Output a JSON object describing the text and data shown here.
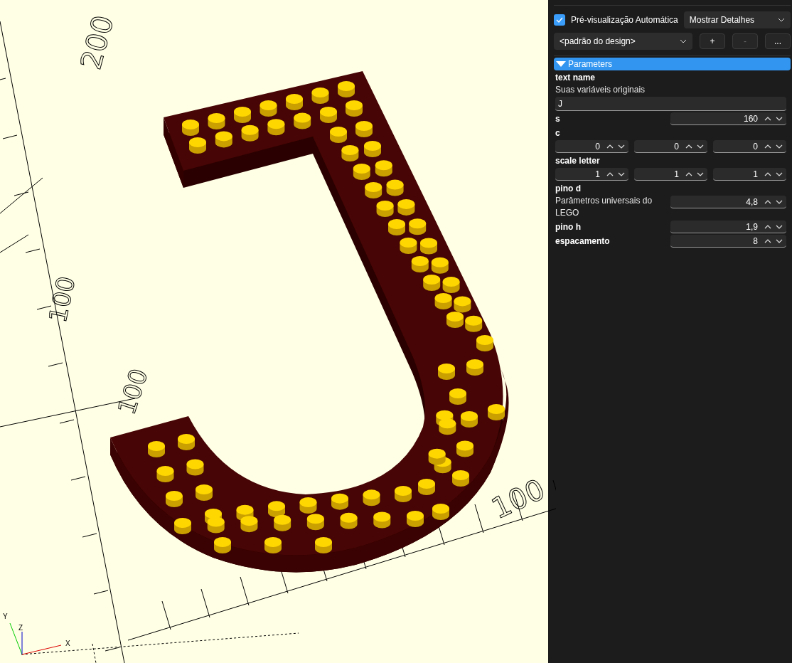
{
  "viewport": {
    "scale_labels": [
      "200",
      "100",
      "100",
      "100"
    ],
    "axis_labels": [
      "X",
      "Y",
      "Z"
    ]
  },
  "customizer": {
    "auto_preview": {
      "label": "Pré-visualização Automática",
      "checked": true
    },
    "detail_select": "Mostrar Detalhes",
    "preset_select": "<padrão do design>",
    "preset_buttons": [
      {
        "label": "+",
        "disabled": false
      },
      {
        "label": "-",
        "disabled": true
      },
      {
        "label": "...",
        "disabled": false
      }
    ],
    "group": {
      "title": "Parameters",
      "expanded": true,
      "params": [
        {
          "name": "text name",
          "description": "Suas variáveis originais",
          "kind": "text",
          "values": [
            "J"
          ]
        },
        {
          "name": "s",
          "kind": "number",
          "values": [
            "160"
          ]
        },
        {
          "name": "c",
          "kind": "vector",
          "values": [
            "0",
            "0",
            "0"
          ]
        },
        {
          "name": "scale letter",
          "kind": "vector",
          "values": [
            "1",
            "1",
            "1"
          ]
        },
        {
          "name": "pino d",
          "description": "Parâmetros universais do LEGO",
          "kind": "number",
          "values": [
            "4,8"
          ]
        },
        {
          "name": "pino h",
          "kind": "number",
          "values": [
            "1,9"
          ]
        },
        {
          "name": "espacamento",
          "kind": "number",
          "values": [
            "8"
          ]
        }
      ]
    }
  }
}
